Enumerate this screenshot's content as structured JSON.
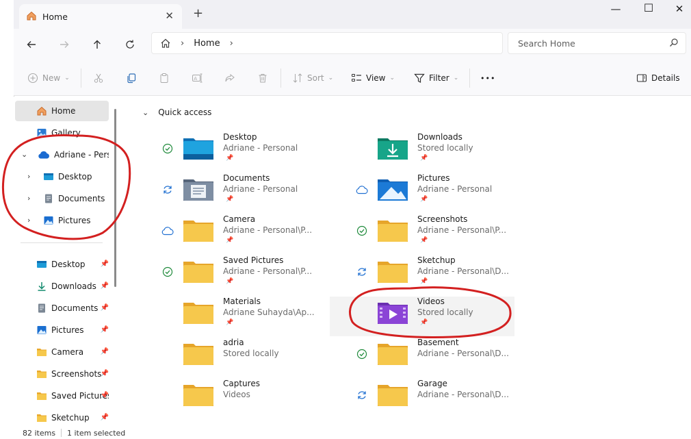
{
  "window": {
    "tab_title": "Home",
    "tab_close": "✕",
    "new_tab": "+",
    "minimize": "—",
    "maximize": "☐",
    "close": "✕"
  },
  "address": {
    "crumb": "Home",
    "search_placeholder": "Search Home"
  },
  "commands": {
    "new": "New",
    "sort": "Sort",
    "view": "View",
    "filter": "Filter",
    "more": "•••",
    "details": "Details"
  },
  "sidebar": {
    "top": [
      {
        "label": "Home",
        "icon": "home-icon"
      },
      {
        "label": "Gallery",
        "icon": "gallery-icon"
      },
      {
        "label": "Adriane - Personal",
        "icon": "onedrive-cloud-icon"
      },
      {
        "label": "Desktop",
        "icon": "desktop-icon"
      },
      {
        "label": "Documents",
        "icon": "documents-icon"
      },
      {
        "label": "Pictures",
        "icon": "pictures-icon"
      }
    ],
    "pinned": [
      {
        "label": "Desktop",
        "icon": "desktop-icon"
      },
      {
        "label": "Downloads",
        "icon": "downloads-icon"
      },
      {
        "label": "Documents",
        "icon": "documents-icon"
      },
      {
        "label": "Pictures",
        "icon": "pictures-icon"
      },
      {
        "label": "Camera",
        "icon": "folder-icon"
      },
      {
        "label": "Screenshots",
        "icon": "folder-icon"
      },
      {
        "label": "Saved Pictures",
        "icon": "folder-icon"
      },
      {
        "label": "Sketchup",
        "icon": "folder-icon"
      }
    ]
  },
  "main": {
    "section_title": "Quick access",
    "items": [
      {
        "name": "Desktop",
        "sub": "Adriane - Personal",
        "status": "synced",
        "icon": "desktop-folder-icon",
        "pinned": true
      },
      {
        "name": "Downloads",
        "sub": "Stored locally",
        "status": "",
        "icon": "downloads-folder-icon",
        "pinned": true
      },
      {
        "name": "Documents",
        "sub": "Adriane - Personal",
        "status": "syncing",
        "icon": "documents-folder-icon",
        "pinned": true
      },
      {
        "name": "Pictures",
        "sub": "Adriane - Personal",
        "status": "cloud",
        "icon": "pictures-folder-icon",
        "pinned": true
      },
      {
        "name": "Camera",
        "sub": "Adriane - Personal\\P...",
        "status": "cloud",
        "icon": "folder-icon",
        "pinned": true
      },
      {
        "name": "Screenshots",
        "sub": "Adriane - Personal\\P...",
        "status": "synced",
        "icon": "folder-icon",
        "pinned": true
      },
      {
        "name": "Saved Pictures",
        "sub": "Adriane - Personal\\P...",
        "status": "synced",
        "icon": "folder-icon",
        "pinned": true
      },
      {
        "name": "Sketchup",
        "sub": "Adriane - Personal\\D...",
        "status": "syncing",
        "icon": "folder-icon",
        "pinned": true
      },
      {
        "name": "Materials",
        "sub": "Adriane Suhayda\\Ap...",
        "status": "",
        "icon": "folder-icon",
        "pinned": true
      },
      {
        "name": "Videos",
        "sub": "Stored locally",
        "status": "",
        "icon": "videos-folder-icon",
        "pinned": true
      },
      {
        "name": "adria",
        "sub": "Stored locally",
        "status": "",
        "icon": "folder-icon",
        "pinned": false
      },
      {
        "name": "Basement",
        "sub": "Adriane - Personal\\D...",
        "status": "synced",
        "icon": "folder-icon",
        "pinned": false
      },
      {
        "name": "Captures",
        "sub": "Videos",
        "status": "",
        "icon": "folder-icon",
        "pinned": false
      },
      {
        "name": "Garage",
        "sub": "Adriane - Personal\\D...",
        "status": "syncing",
        "icon": "folder-icon",
        "pinned": false
      }
    ]
  },
  "status": {
    "count": "82 items",
    "selection": "1 item selected"
  },
  "colors": {
    "annotation": "#d32020",
    "folder": "#f3c443",
    "accent": "#0067c0"
  }
}
